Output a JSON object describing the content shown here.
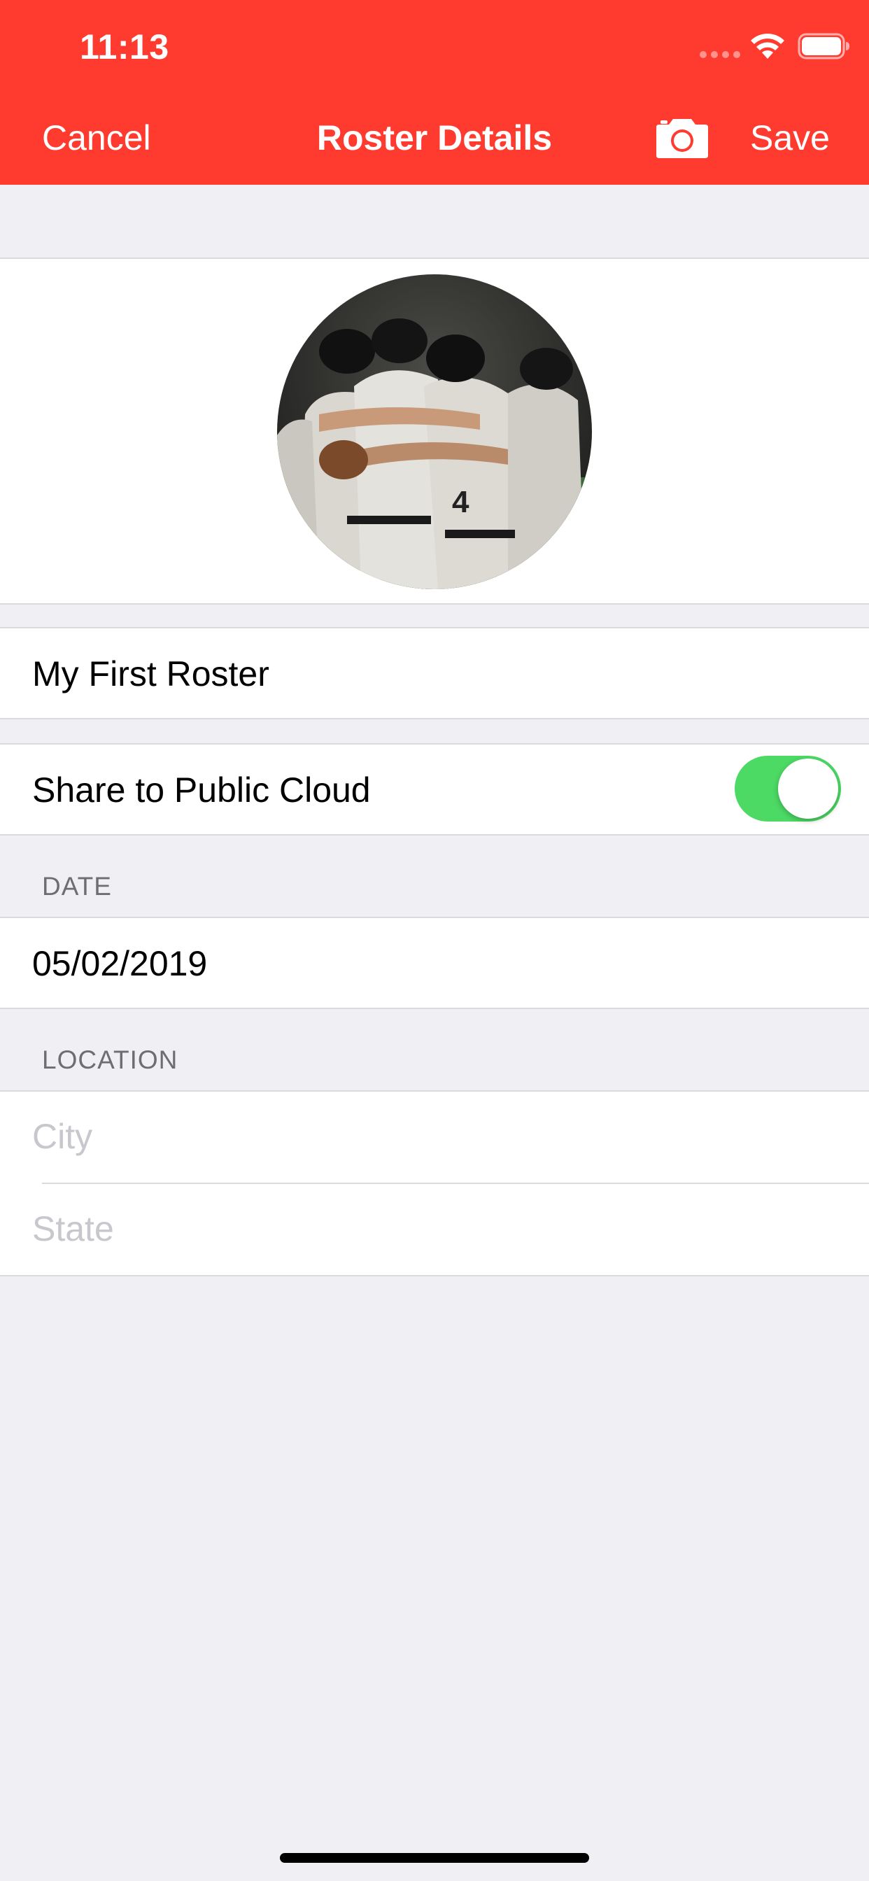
{
  "status_bar": {
    "time": "11:13"
  },
  "nav": {
    "cancel_label": "Cancel",
    "title": "Roster Details",
    "save_label": "Save",
    "camera_icon": "camera-icon",
    "accent_color": "#FF3B30"
  },
  "roster": {
    "name": "My First Roster",
    "share_label": "Share to Public Cloud",
    "share_enabled": true,
    "toggle_color": "#4CD964"
  },
  "date_section": {
    "header": "DATE",
    "value": "05/02/2019"
  },
  "location_section": {
    "header": "LOCATION",
    "city_placeholder": "City",
    "state_placeholder": "State"
  }
}
